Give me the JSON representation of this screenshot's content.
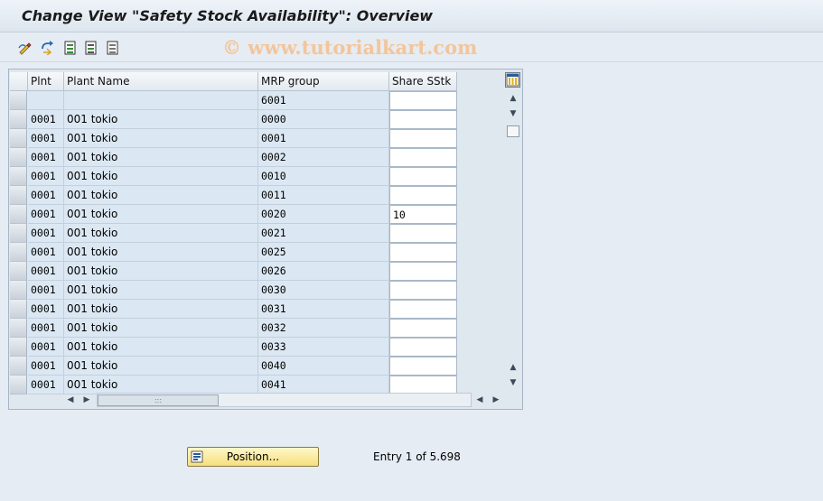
{
  "window": {
    "title": "Change View \"Safety Stock Availability\": Overview",
    "watermark": "© www.tutorialkart.com"
  },
  "toolbar": {
    "icons": [
      "display-change-icon",
      "undo-icon",
      "select-all-icon",
      "select-block-icon",
      "deselect-all-icon"
    ]
  },
  "table": {
    "columns": [
      "Plnt",
      "Plant Name",
      "MRP group",
      "Share SStk"
    ],
    "rows": [
      {
        "plnt": "",
        "plant_name": "",
        "mrp_group": "6001",
        "share": ""
      },
      {
        "plnt": "0001",
        "plant_name": "001 tokio",
        "mrp_group": "0000",
        "share": ""
      },
      {
        "plnt": "0001",
        "plant_name": "001 tokio",
        "mrp_group": "0001",
        "share": ""
      },
      {
        "plnt": "0001",
        "plant_name": "001 tokio",
        "mrp_group": "0002",
        "share": ""
      },
      {
        "plnt": "0001",
        "plant_name": "001 tokio",
        "mrp_group": "0010",
        "share": ""
      },
      {
        "plnt": "0001",
        "plant_name": "001 tokio",
        "mrp_group": "0011",
        "share": ""
      },
      {
        "plnt": "0001",
        "plant_name": "001 tokio",
        "mrp_group": "0020",
        "share": "10"
      },
      {
        "plnt": "0001",
        "plant_name": "001 tokio",
        "mrp_group": "0021",
        "share": ""
      },
      {
        "plnt": "0001",
        "plant_name": "001 tokio",
        "mrp_group": "0025",
        "share": ""
      },
      {
        "plnt": "0001",
        "plant_name": "001 tokio",
        "mrp_group": "0026",
        "share": ""
      },
      {
        "plnt": "0001",
        "plant_name": "001 tokio",
        "mrp_group": "0030",
        "share": ""
      },
      {
        "plnt": "0001",
        "plant_name": "001 tokio",
        "mrp_group": "0031",
        "share": ""
      },
      {
        "plnt": "0001",
        "plant_name": "001 tokio",
        "mrp_group": "0032",
        "share": ""
      },
      {
        "plnt": "0001",
        "plant_name": "001 tokio",
        "mrp_group": "0033",
        "share": ""
      },
      {
        "plnt": "0001",
        "plant_name": "001 tokio",
        "mrp_group": "0040",
        "share": ""
      },
      {
        "plnt": "0001",
        "plant_name": "001 tokio",
        "mrp_group": "0041",
        "share": ""
      }
    ]
  },
  "footer": {
    "position_label": "Position...",
    "entry_text": "Entry 1 of 5.698"
  }
}
